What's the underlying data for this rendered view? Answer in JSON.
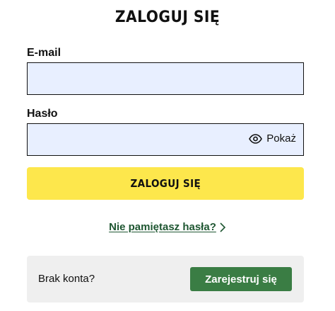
{
  "login_form": {
    "title": "ZALOGUJ SIĘ",
    "email": {
      "label": "E-mail",
      "value": "",
      "placeholder": ""
    },
    "password": {
      "label": "Hasło",
      "value": "",
      "placeholder": "",
      "show_label": "Pokaż",
      "show_icon": "eye-icon"
    },
    "submit_label": "ZALOGUJ SIĘ",
    "forgot_password": {
      "label": "Nie pamiętasz hasła?",
      "icon": "chevron-right-icon"
    }
  },
  "register": {
    "text": "Brak konta?",
    "button_label": "Zarejestruj się"
  },
  "colors": {
    "input_background": "#e8efff",
    "primary_button": "#fde74c",
    "link": "#1e5631",
    "register_button": "#3a7d44",
    "register_panel": "#efefef"
  }
}
